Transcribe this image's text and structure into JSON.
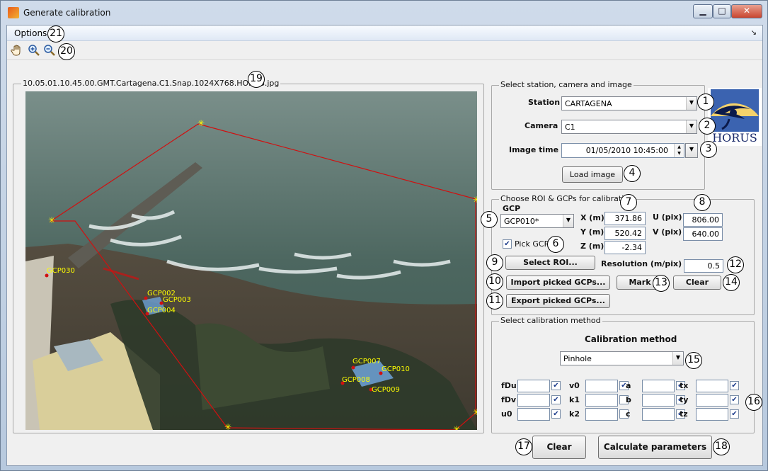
{
  "window": {
    "title": "Generate calibration",
    "minimize": "▁",
    "maximize": "□",
    "close": "✕"
  },
  "menu": {
    "options": "Options",
    "expand_icon": "↘"
  },
  "toolbar": {
    "tools": [
      "pan-icon",
      "zoom-in-icon",
      "zoom-out-icon"
    ]
  },
  "callouts": [
    "1",
    "2",
    "3",
    "4",
    "5",
    "6",
    "7",
    "8",
    "9",
    "10",
    "11",
    "12",
    "13",
    "14",
    "15",
    "16",
    "17",
    "18",
    "19",
    "20",
    "21"
  ],
  "image_panel": {
    "title": "10.05.01.10.45.00.GMT.Cartagena.C1.Snap.1024X768.HORUS.jpg"
  },
  "gcp_markers": [
    "GCP030",
    "GCP002",
    "GCP003",
    "GCP004",
    "GCP007",
    "GCP010",
    "GCP008",
    "GCP009"
  ],
  "logo": {
    "text": "HORUS"
  },
  "station_panel": {
    "legend": "Select station, camera and image",
    "station_label": "Station",
    "station_value": "CARTAGENA",
    "camera_label": "Camera",
    "camera_value": "C1",
    "time_label": "Image time",
    "time_value": "01/05/2010 10:45:00",
    "load_button": "Load image"
  },
  "roi_panel": {
    "legend": "Choose ROI & GCPs for calibration",
    "gcp_label": "GCP",
    "gcp_value": "GCP010*",
    "x_label": "X (m)",
    "x_value": "371.86",
    "y_label": "Y (m)",
    "y_value": "520.42",
    "z_label": "Z (m)",
    "z_value": "-2.34",
    "u_label": "U (pix)",
    "u_value": "806.00",
    "v_label": "V (pix)",
    "v_value": "640.00",
    "pick_label": "Pick GCP",
    "pick_checked": true,
    "select_roi": "Select ROI...",
    "resolution_label": "Resolution (m/pix)",
    "resolution_value": "0.5",
    "import_button": "Import picked GCPs...",
    "export_button": "Export picked GCPs...",
    "mark_button": "Mark",
    "clear_button": "Clear"
  },
  "method_panel": {
    "legend": "Select calibration method",
    "heading": "Calibration method",
    "method_value": "Pinhole",
    "params": [
      {
        "label": "fDu",
        "checked": true
      },
      {
        "label": "v0",
        "checked": true
      },
      {
        "label": "a",
        "checked": true
      },
      {
        "label": "tx",
        "checked": true
      },
      {
        "label": "fDv",
        "checked": true
      },
      {
        "label": "k1",
        "checked": false
      },
      {
        "label": "b",
        "checked": true
      },
      {
        "label": "ty",
        "checked": true
      },
      {
        "label": "u0",
        "checked": true
      },
      {
        "label": "k2",
        "checked": false
      },
      {
        "label": "c",
        "checked": true
      },
      {
        "label": "tz",
        "checked": true
      }
    ]
  },
  "bottom": {
    "clear_button": "Clear",
    "calculate_button": "Calculate parameters"
  },
  "colors": {
    "roi_line": "#d01010",
    "gcp_label": "#ffff00",
    "callout_border": "#000000"
  }
}
